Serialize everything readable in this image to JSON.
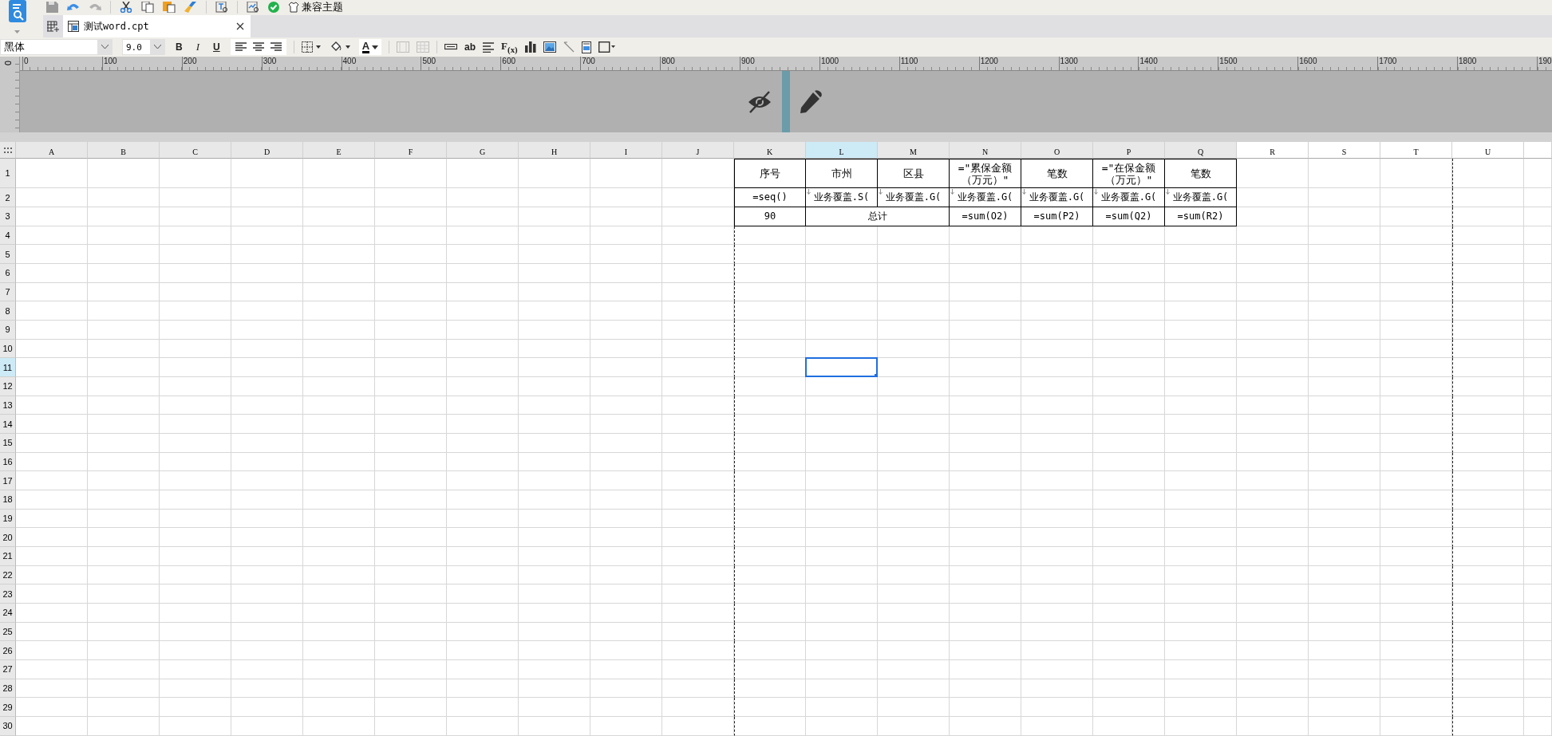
{
  "quick_toolbar": {
    "theme_button": "兼容主题"
  },
  "tabs": [
    {
      "label": "测试word.cpt",
      "selected": true
    }
  ],
  "format_toolbar": {
    "font": "黑体",
    "font_size": "9.0",
    "bold": "B",
    "italic": "I",
    "underline": "U",
    "font_color": "A",
    "text_tool": "ab",
    "formula": "F$_{(x)}$"
  },
  "ruler": {
    "labels": [
      "0",
      "100",
      "200",
      "300",
      "400",
      "500",
      "600",
      "700",
      "800",
      "900",
      "1000",
      "1100",
      "1200",
      "1300",
      "1400",
      "1500",
      "1600",
      "1700",
      "1800",
      "190"
    ],
    "vertical_label": "0"
  },
  "sheet": {
    "columns": [
      {
        "label": "A",
        "selected": false
      },
      {
        "label": "B",
        "selected": false
      },
      {
        "label": "C",
        "selected": false
      },
      {
        "label": "D",
        "selected": false
      },
      {
        "label": "E",
        "selected": false
      },
      {
        "label": "F",
        "selected": false
      },
      {
        "label": "G",
        "selected": false
      },
      {
        "label": "H",
        "selected": false
      },
      {
        "label": "I",
        "selected": false
      },
      {
        "label": "J",
        "selected": false
      },
      {
        "label": "K",
        "selected": false
      },
      {
        "label": "L",
        "selected": true
      },
      {
        "label": "M",
        "selected": false
      },
      {
        "label": "N",
        "selected": false
      },
      {
        "label": "O",
        "selected": false
      },
      {
        "label": "P",
        "selected": false
      },
      {
        "label": "Q",
        "selected": false
      },
      {
        "label": "R",
        "selected": false
      },
      {
        "label": "S",
        "selected": false
      },
      {
        "label": "T",
        "selected": false
      },
      {
        "label": "U",
        "selected": false
      }
    ],
    "rows": [
      {
        "label": "1",
        "selected": false
      },
      {
        "label": "2",
        "selected": false
      },
      {
        "label": "3",
        "selected": false
      },
      {
        "label": "4",
        "selected": false
      },
      {
        "label": "5",
        "selected": false
      },
      {
        "label": "6",
        "selected": false
      },
      {
        "label": "7",
        "selected": false
      },
      {
        "label": "8",
        "selected": false
      },
      {
        "label": "9",
        "selected": false
      },
      {
        "label": "10",
        "selected": false
      },
      {
        "label": "11",
        "selected": true
      },
      {
        "label": "12",
        "selected": false
      },
      {
        "label": "13",
        "selected": false
      },
      {
        "label": "14",
        "selected": false
      },
      {
        "label": "15",
        "selected": false
      },
      {
        "label": "16",
        "selected": false
      },
      {
        "label": "17",
        "selected": false
      },
      {
        "label": "18",
        "selected": false
      },
      {
        "label": "19",
        "selected": false
      },
      {
        "label": "20",
        "selected": false
      },
      {
        "label": "21",
        "selected": false
      },
      {
        "label": "22",
        "selected": false
      },
      {
        "label": "23",
        "selected": false
      },
      {
        "label": "24",
        "selected": false
      },
      {
        "label": "25",
        "selected": false
      },
      {
        "label": "26",
        "selected": false
      },
      {
        "label": "27",
        "selected": false
      },
      {
        "label": "28",
        "selected": false
      },
      {
        "label": "29",
        "selected": false
      },
      {
        "label": "30",
        "selected": false
      }
    ],
    "table": {
      "rows": [
        [
          {
            "text": "序号",
            "wide": false,
            "expand": false
          },
          {
            "text": "市州",
            "wide": false,
            "expand": false
          },
          {
            "text": "区县",
            "wide": false,
            "expand": false
          },
          {
            "text": "=\"累保金额（万元）\"",
            "wide": false,
            "expand": false
          },
          {
            "text": "笔数",
            "wide": false,
            "expand": false
          },
          {
            "text": "=\"在保金额（万元）\"",
            "wide": false,
            "expand": false
          },
          {
            "text": "笔数",
            "wide": false,
            "expand": false
          }
        ],
        [
          {
            "text": "=seq()",
            "wide": false,
            "expand": false
          },
          {
            "text": "业务覆盖.S(",
            "wide": false,
            "expand": true
          },
          {
            "text": "业务覆盖.G(",
            "wide": false,
            "expand": true
          },
          {
            "text": "业务覆盖.G(",
            "wide": false,
            "expand": true
          },
          {
            "text": "业务覆盖.G(",
            "wide": false,
            "expand": true
          },
          {
            "text": "业务覆盖.G(",
            "wide": false,
            "expand": true
          },
          {
            "text": "业务覆盖.G(",
            "wide": false,
            "expand": true
          }
        ],
        [
          {
            "text": "90",
            "wide": false,
            "expand": false
          },
          {
            "text": "总计",
            "wide": true,
            "expand": false
          },
          {
            "covered": true
          },
          {
            "text": "=sum(O2)",
            "wide": false,
            "expand": false
          },
          {
            "text": "=sum(P2)",
            "wide": false,
            "expand": false
          },
          {
            "text": "=sum(Q2)",
            "wide": false,
            "expand": false
          },
          {
            "text": "=sum(R2)",
            "wide": false,
            "expand": false
          }
        ]
      ]
    }
  }
}
